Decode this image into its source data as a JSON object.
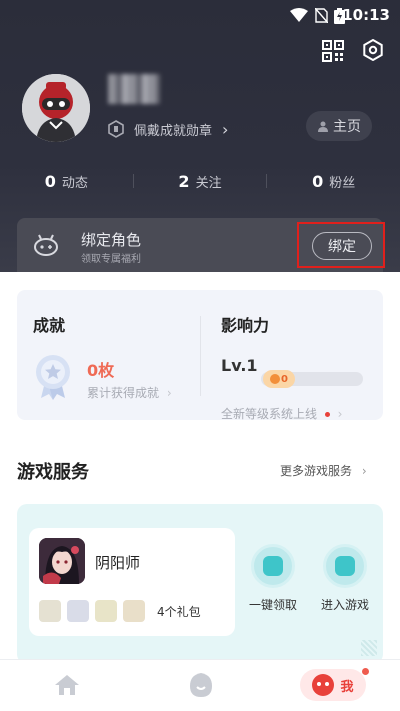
{
  "status_bar": {
    "time": "10:13"
  },
  "profile": {
    "badge_label": "佩戴成就勋章",
    "home_button": "主页"
  },
  "stats": [
    {
      "count": "0",
      "label": "动态"
    },
    {
      "count": "2",
      "label": "关注"
    },
    {
      "count": "0",
      "label": "粉丝"
    }
  ],
  "bind_role": {
    "title": "绑定角色",
    "subtitle": "领取专属福利",
    "button": "绑定"
  },
  "achievement": {
    "title": "成就",
    "count": "0枚",
    "subtitle": "累计获得成就"
  },
  "influence": {
    "title": "影响力",
    "level": "Lv.1",
    "progress_value": "0",
    "progress_fraction": 0,
    "subtitle": "全新等级系统上线"
  },
  "game_services": {
    "title": "游戏服务",
    "more": "更多游戏服务",
    "game": {
      "name": "阴阳师",
      "gift_count_label": "4个礼包"
    },
    "actions": [
      "一键领取",
      "进入游戏"
    ]
  },
  "bottom_nav": {
    "me_label": "我"
  },
  "colors": {
    "header_bg": "#2b2d3a",
    "accent_red": "#e8413a",
    "achievement_orange": "#ef6a55",
    "teal": "#3ec5c9"
  }
}
